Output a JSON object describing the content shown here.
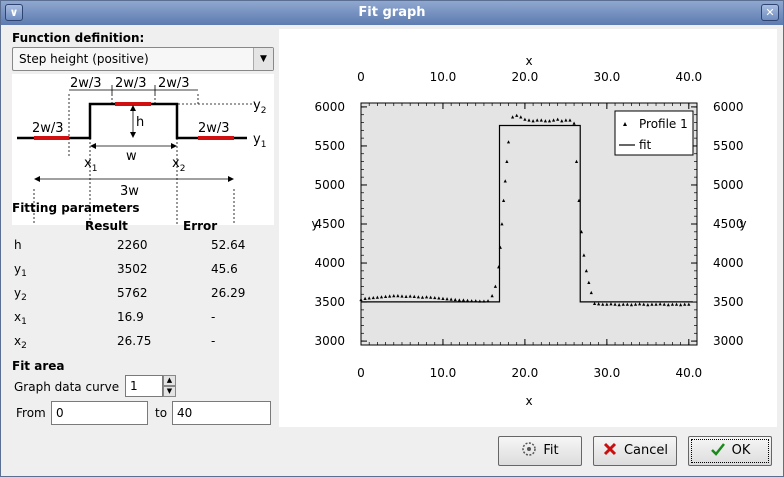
{
  "window": {
    "title": "Fit graph"
  },
  "function_definition": {
    "heading": "Function definition:",
    "selected": "Step height (positive)"
  },
  "diagram": {
    "y2": "y",
    "y2_sub": "2",
    "y1": "y",
    "y1_sub": "1",
    "third_label": "2w/3",
    "h": "h",
    "w": "w",
    "full_width": "3w",
    "x1": "x",
    "x1_sub": "1",
    "x2": "x",
    "x2_sub": "2"
  },
  "fitting": {
    "heading": "Fitting parameters",
    "col_result": "Result",
    "col_error": "Error",
    "rows": [
      {
        "name": "h",
        "sub": "",
        "result": "2260",
        "error": "52.64"
      },
      {
        "name": "y",
        "sub": "1",
        "result": "3502",
        "error": "45.6"
      },
      {
        "name": "y",
        "sub": "2",
        "result": "5762",
        "error": "26.29"
      },
      {
        "name": "x",
        "sub": "1",
        "result": "16.9",
        "error": "-"
      },
      {
        "name": "x",
        "sub": "2",
        "result": "26.75",
        "error": "-"
      }
    ]
  },
  "fit_area": {
    "heading": "Fit area",
    "curve_label": "Graph data curve",
    "curve_value": "1",
    "from_label": "From",
    "from_value": "0",
    "to_label": "to",
    "to_value": "40"
  },
  "buttons": {
    "fit": "Fit",
    "cancel": "Cancel",
    "ok": "OK"
  },
  "chart_data": {
    "type": "scatter",
    "xlabel": "x",
    "ylabel": "y",
    "xlim": [
      0,
      41
    ],
    "ylim": [
      2950,
      6050
    ],
    "xticks": [
      0,
      10,
      20,
      30,
      40
    ],
    "xtick_labels": [
      "0",
      "10.0",
      "20.0",
      "30.0",
      "40.0"
    ],
    "yticks": [
      3000,
      3500,
      4000,
      4500,
      5000,
      5500,
      6000
    ],
    "ytick_labels": [
      "3000",
      "3500",
      "4000",
      "4500",
      "5000",
      "5500",
      "6000"
    ],
    "legend_position": "top-right",
    "series": [
      {
        "name": "Profile 1",
        "style": "points",
        "x": [
          0.0,
          0.5,
          1.0,
          1.5,
          2.0,
          2.5,
          3.0,
          3.5,
          4.0,
          4.5,
          5.0,
          5.5,
          6.0,
          6.5,
          7.0,
          7.5,
          8.0,
          8.5,
          9.0,
          9.5,
          10.0,
          10.5,
          11.0,
          11.5,
          12.0,
          12.5,
          13.0,
          13.5,
          14.0,
          14.5,
          15.0,
          15.5,
          16.0,
          16.4,
          16.8,
          17.0,
          17.2,
          17.4,
          17.6,
          17.8,
          18.0,
          18.5,
          19.0,
          19.5,
          20.0,
          20.5,
          21.0,
          21.5,
          22.0,
          22.5,
          23.0,
          23.5,
          24.0,
          24.5,
          25.0,
          25.5,
          26.0,
          26.3,
          26.6,
          26.9,
          27.2,
          27.5,
          27.8,
          28.1,
          28.5,
          29.0,
          29.5,
          30.0,
          30.5,
          31.0,
          31.5,
          32.0,
          32.5,
          33.0,
          33.5,
          34.0,
          34.5,
          35.0,
          35.5,
          36.0,
          36.5,
          37.0,
          37.5,
          38.0,
          38.5,
          39.0,
          39.5,
          40.0
        ],
        "y": [
          3530,
          3545,
          3550,
          3555,
          3560,
          3565,
          3570,
          3575,
          3580,
          3580,
          3575,
          3570,
          3575,
          3570,
          3565,
          3560,
          3565,
          3560,
          3555,
          3550,
          3545,
          3540,
          3535,
          3530,
          3525,
          3525,
          3520,
          3515,
          3515,
          3510,
          3510,
          3515,
          3580,
          3700,
          3950,
          4200,
          4500,
          4800,
          5050,
          5300,
          5550,
          5870,
          5890,
          5870,
          5840,
          5830,
          5820,
          5830,
          5830,
          5820,
          5820,
          5830,
          5840,
          5820,
          5830,
          5830,
          5790,
          5300,
          4800,
          4400,
          4100,
          3900,
          3750,
          3620,
          3480,
          3475,
          3470,
          3470,
          3475,
          3470,
          3465,
          3470,
          3470,
          3465,
          3470,
          3475,
          3470,
          3465,
          3470,
          3470,
          3475,
          3470,
          3465,
          3470,
          3470,
          3465,
          3470,
          3470
        ]
      },
      {
        "name": "fit",
        "style": "line",
        "x": [
          0,
          16.9,
          16.9,
          26.75,
          26.75,
          40.5
        ],
        "y": [
          3502,
          3502,
          5762,
          5762,
          3502,
          3502
        ]
      }
    ]
  }
}
